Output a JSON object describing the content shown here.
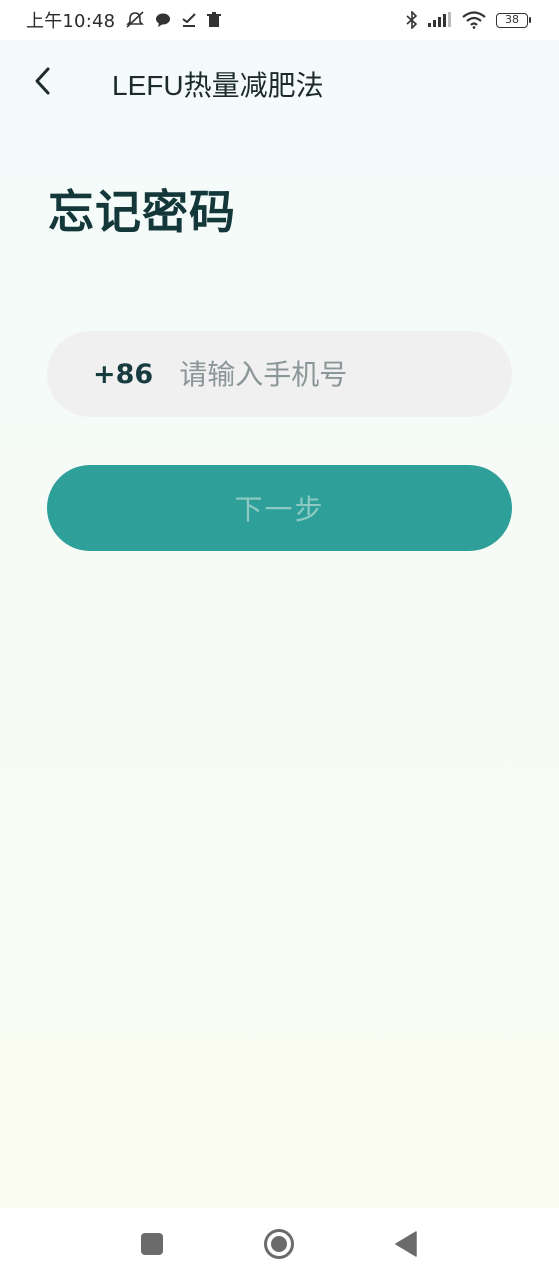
{
  "status_bar": {
    "time": "上午10:48",
    "battery": "38",
    "icons": [
      "mute-alarm-icon",
      "chat-bubble-icon",
      "check-icon",
      "trash-icon",
      "bluetooth-icon",
      "signal-icon",
      "wifi-icon",
      "battery-icon"
    ]
  },
  "header": {
    "title": "LEFU热量减肥法",
    "back_icon": "chevron-left-icon"
  },
  "page": {
    "title": "忘记密码"
  },
  "phone": {
    "country_code": "+86",
    "placeholder": "请输入手机号",
    "value": ""
  },
  "next_button": {
    "label": "下一步"
  },
  "nav_bar": {
    "icons": [
      "recents-square-icon",
      "home-circle-icon",
      "back-triangle-icon"
    ]
  },
  "colors": {
    "accent": "#2e9f99",
    "title": "#14373a",
    "input_bg": "#f0f0f0",
    "button_text_disabled": "#8fc9c4"
  }
}
